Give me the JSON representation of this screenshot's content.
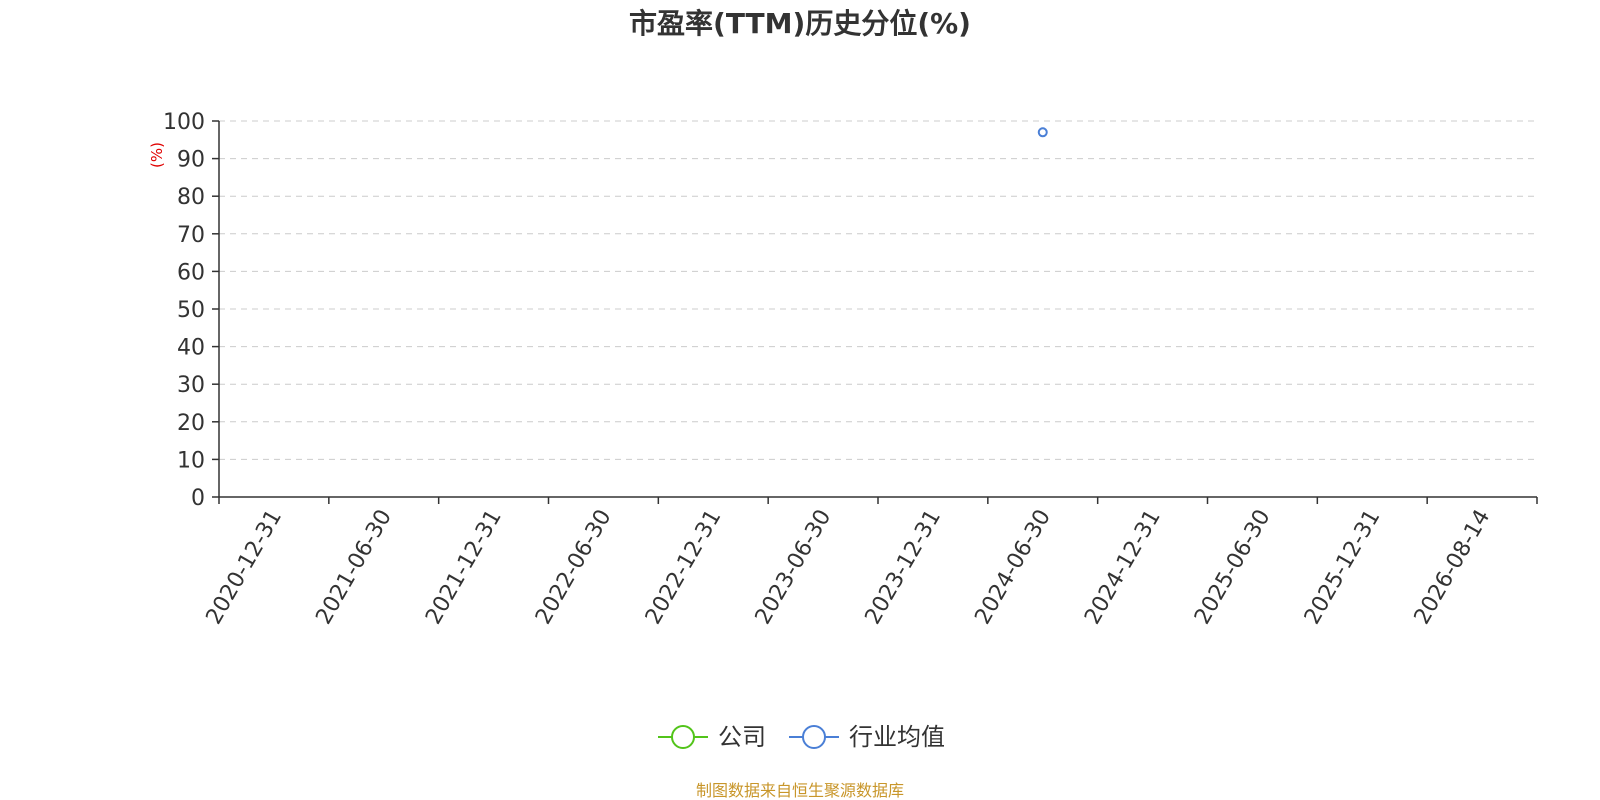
{
  "chart_data": {
    "type": "line",
    "title": "市盈率(TTM)历史分位(%)",
    "ylabel": "(%)",
    "xlabel": "",
    "ylim": [
      0,
      100
    ],
    "y_ticks": [
      "0",
      "10",
      "20",
      "30",
      "40",
      "50",
      "60",
      "70",
      "80",
      "90",
      "100"
    ],
    "categories": [
      "2020-12-31",
      "2021-06-30",
      "2021-12-31",
      "2022-06-30",
      "2022-12-31",
      "2023-06-30",
      "2023-12-31",
      "2024-06-30",
      "2024-12-31",
      "2025-06-30",
      "2025-12-31",
      "2026-08-14"
    ],
    "grid": true,
    "series": [
      {
        "name": "公司",
        "color": "#52c41a",
        "points": []
      },
      {
        "name": "行业均值",
        "color": "#4a7fd6",
        "points": [
          {
            "x": 7.5,
            "y": 97
          }
        ]
      }
    ],
    "legend_position": "bottom"
  },
  "footer": {
    "source": "制图数据来自恒生聚源数据库",
    "source_color": "#c8962a"
  }
}
